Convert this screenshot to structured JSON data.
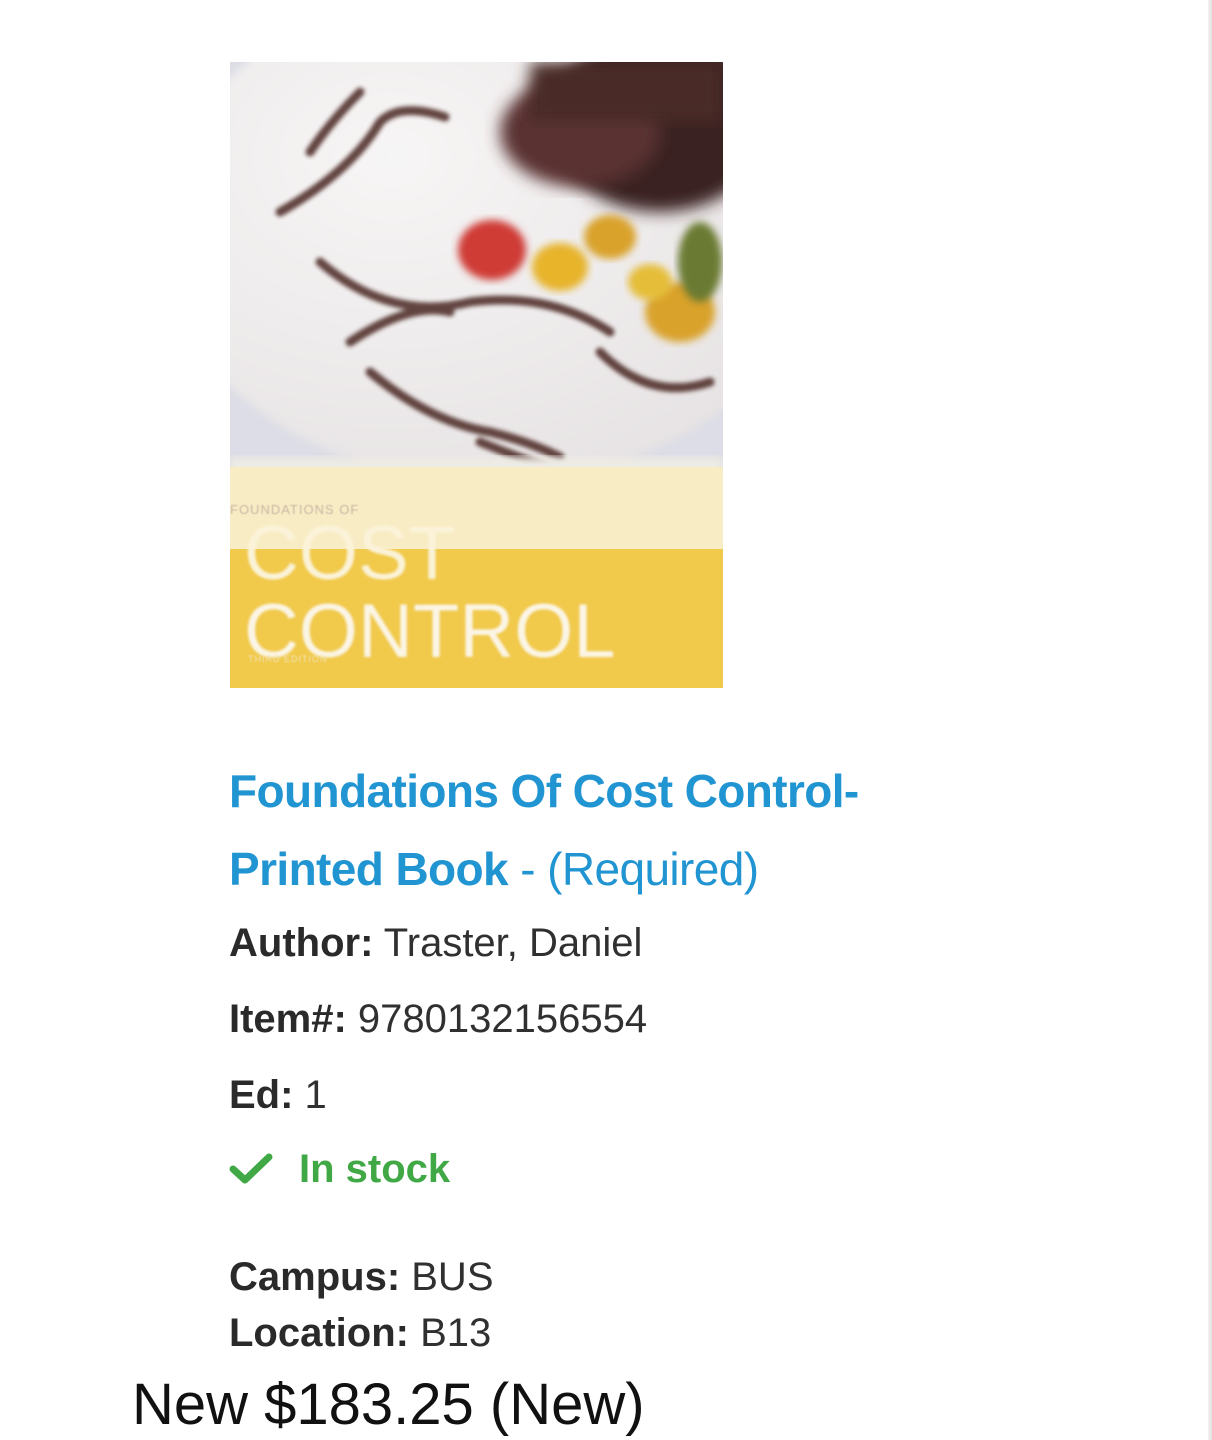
{
  "product": {
    "cover": {
      "series_text": "FOUNDATIONS OF",
      "title_line1": "COST",
      "title_line2": "CONTROL",
      "edition_text": "THIRD EDITION",
      "colors": {
        "band_light": "#f8ecc4",
        "band_dark": "#f1c94b",
        "plate": "#ece9ec"
      }
    },
    "title": "Foundations Of Cost Control- Printed Book",
    "title_separator": " - ",
    "requirement": "(Required)",
    "author": {
      "label": "Author:",
      "value": " Traster, Daniel"
    },
    "item": {
      "label": "Item#:",
      "value": " 9780132156554"
    },
    "edition": {
      "label": "Ed:",
      "value": " 1"
    },
    "stock": {
      "icon": "checkmark-icon",
      "label": "In stock",
      "color": "#40a845"
    },
    "campus": {
      "label": "Campus:",
      "value": " BUS"
    },
    "location": {
      "label": "Location:",
      "value": " B13"
    },
    "price": "New $183.25 (New)"
  },
  "colors": {
    "link": "#2194d2",
    "text": "#2b2b2b",
    "in_stock": "#40a845"
  }
}
